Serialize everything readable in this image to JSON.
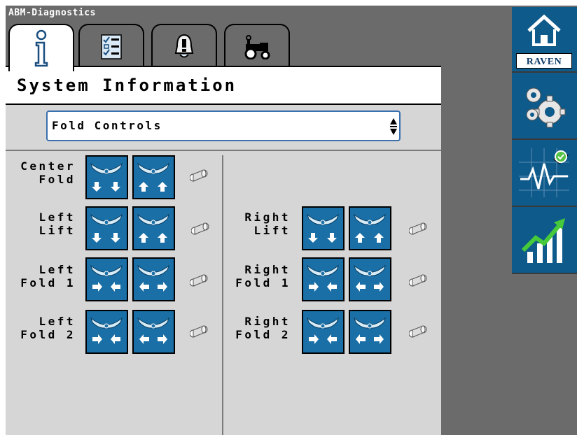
{
  "window": {
    "title": "ABM-Diagnostics"
  },
  "tabs": [
    {
      "name": "info-icon",
      "active": true
    },
    {
      "name": "checklist-icon",
      "active": false
    },
    {
      "name": "alarm-bell-icon",
      "active": false
    },
    {
      "name": "tractor-icon",
      "active": false
    }
  ],
  "page": {
    "title": "System Information"
  },
  "selector": {
    "value": "Fold Controls"
  },
  "controls": {
    "center_fold": "Center\nFold",
    "left_lift": "Left\nLift",
    "right_lift": "Right\nLift",
    "left_fold_1": "Left\nFold 1",
    "right_fold_1": "Right\nFold 1",
    "left_fold_2": "Left\nFold 2",
    "right_fold_2": "Right\nFold 2"
  },
  "sidebar": {
    "home_brand": "RAVEN",
    "items": [
      "home-icon",
      "settings-gears-icon",
      "diagnostics-pulse-icon",
      "performance-chart-icon"
    ]
  },
  "colors": {
    "accent": "#1a6fa6",
    "sidebar": "#0e5a8a",
    "background": "#6b6b6b",
    "panel": "#d6d6d6"
  }
}
